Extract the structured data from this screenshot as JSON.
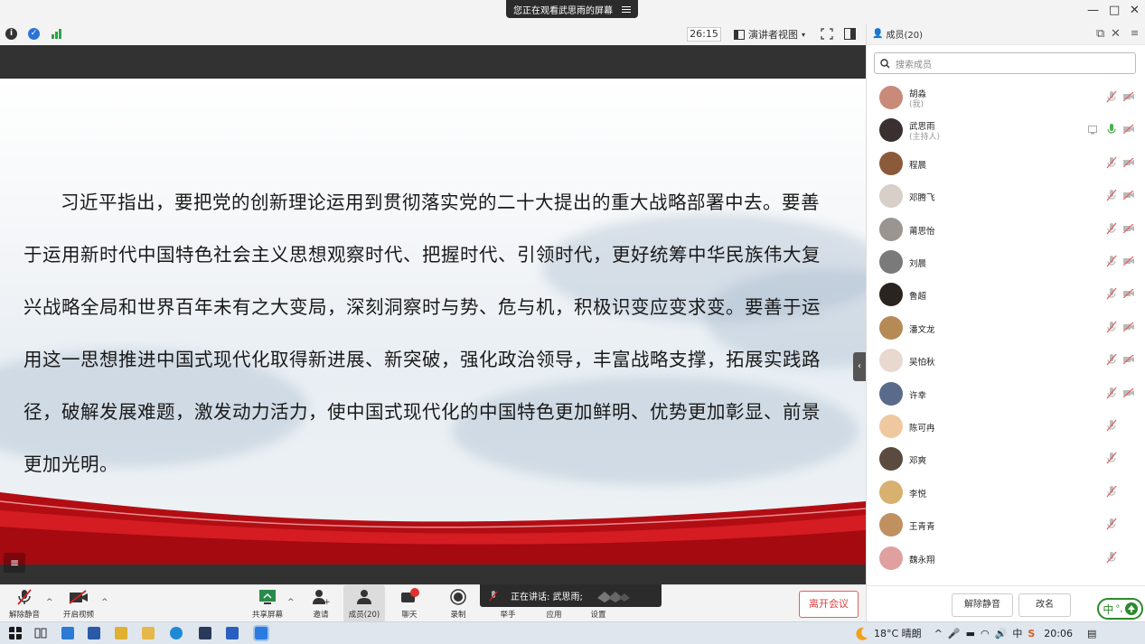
{
  "top": {
    "share_banner": "您正在观看武思雨的屏幕",
    "window_controls": {
      "minimize": "—",
      "restore": "ㅁ",
      "close": "✕"
    }
  },
  "viewer": {
    "timer": "26:15",
    "view_mode": "演讲者视图"
  },
  "slide": {
    "text": "习近平指出，要把党的创新理论运用到贯彻落实党的二十大提出的重大战略部署中去。要善于运用新时代中国特色社会主义思想观察时代、把握时代、引领时代，更好统筹中华民族伟大复兴战略全局和世界百年未有之大变局，深刻洞察时与势、危与机，积极识变应变求变。要善于运用这一思想推进中国式现代化取得新进展、新突破，强化政治领导，丰富战略支撑，拓展实践路径，破解发展难题，激发动力活力，使中国式现代化的中国特色更加鲜明、优势更加彰显、前景更加光明。"
  },
  "members_panel": {
    "title": "成员(20)",
    "search_placeholder": "搜索成员",
    "members": [
      {
        "name": "胡淼",
        "sub": "(我)",
        "avatar_color": "#c98a7a",
        "mic": "muted",
        "cam": "off"
      },
      {
        "name": "武思雨",
        "sub": "(主持人)",
        "avatar_color": "#3a3030",
        "mic": "on",
        "cam": "off"
      },
      {
        "name": "程晨",
        "sub": "",
        "avatar_color": "#8a5a3a",
        "mic": "muted",
        "cam": "off"
      },
      {
        "name": "邓腾飞",
        "sub": "",
        "avatar_color": "#d8d0c8",
        "mic": "muted",
        "cam": "off"
      },
      {
        "name": "莆思怡",
        "sub": "",
        "avatar_color": "#9a9590",
        "mic": "muted",
        "cam": "off"
      },
      {
        "name": "刘晨",
        "sub": "",
        "avatar_color": "#7a7a7a",
        "mic": "muted",
        "cam": "off"
      },
      {
        "name": "鲁超",
        "sub": "",
        "avatar_color": "#2a2420",
        "mic": "muted",
        "cam": "off"
      },
      {
        "name": "潘文龙",
        "sub": "",
        "avatar_color": "#b58a55",
        "mic": "muted",
        "cam": "off"
      },
      {
        "name": "吴怕秋",
        "sub": "",
        "avatar_color": "#e8d8d0",
        "mic": "muted",
        "cam": "off"
      },
      {
        "name": "许幸",
        "sub": "",
        "avatar_color": "#5a6a8a",
        "mic": "muted",
        "cam": "off"
      },
      {
        "name": "陈可冉",
        "sub": "",
        "avatar_color": "#f0c8a0",
        "mic": "muted",
        "cam": ""
      },
      {
        "name": "邓爽",
        "sub": "",
        "avatar_color": "#5a4a40",
        "mic": "muted",
        "cam": ""
      },
      {
        "name": "李悦",
        "sub": "",
        "avatar_color": "#d8b070",
        "mic": "muted",
        "cam": ""
      },
      {
        "name": "王青青",
        "sub": "",
        "avatar_color": "#c09060",
        "mic": "muted",
        "cam": ""
      },
      {
        "name": "魏永翔",
        "sub": "",
        "avatar_color": "#e0a0a0",
        "mic": "muted",
        "cam": ""
      }
    ],
    "footer": {
      "unmute_all": "解除静音",
      "rename": "改名"
    }
  },
  "toolbar": {
    "unmute": "解除静音",
    "start_video": "开启视频",
    "share_screen": "共享屏幕",
    "invite": "邀请",
    "members": "成员(20)",
    "chat": "聊天",
    "record": "录制",
    "raise_hand": "举手",
    "apps": "应用",
    "settings": "设置",
    "leave": "离开会议",
    "speaking_label": "正在讲话: 武思雨;"
  },
  "taskbar": {
    "weather": "18°C 晴朗",
    "time": "20:06",
    "ime": "中"
  },
  "colors": {
    "accent_red": "#c8141b",
    "leave_red": "#e04040",
    "bar_dark": "#2b2b2b"
  }
}
